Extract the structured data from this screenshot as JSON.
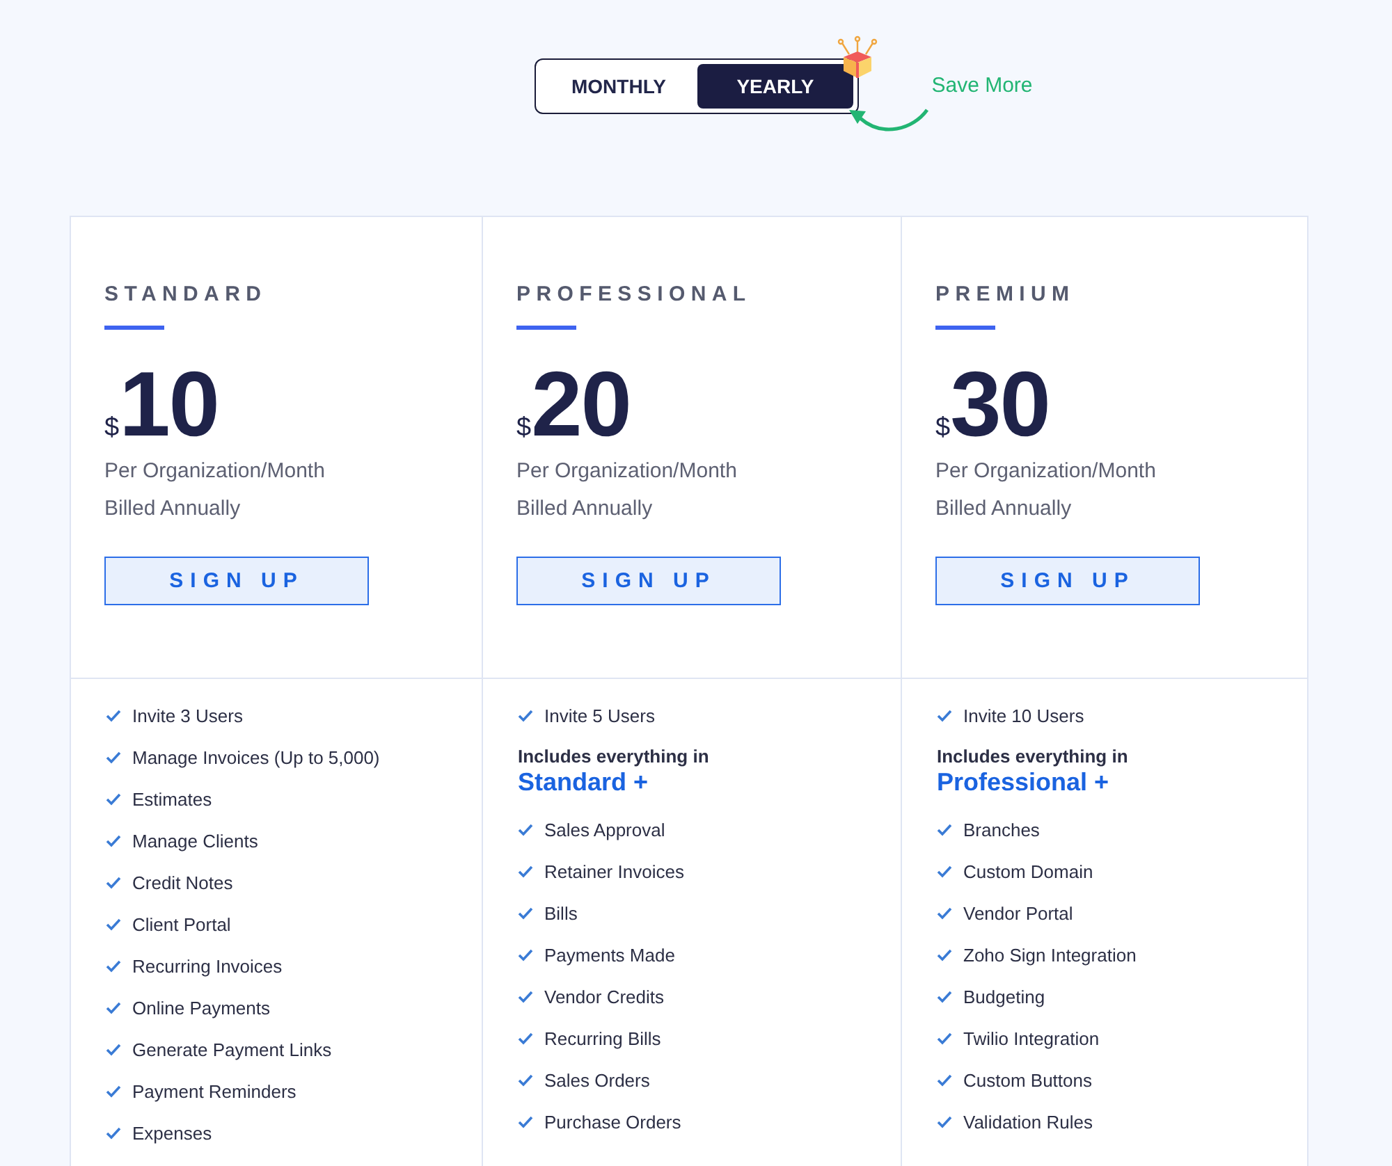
{
  "billing_toggle": {
    "options": [
      {
        "label": "MONTHLY",
        "selected": false
      },
      {
        "label": "YEARLY",
        "selected": true
      }
    ],
    "promo": "Save More"
  },
  "plans": [
    {
      "name": "STANDARD",
      "currency": "$",
      "price": "10",
      "period": "Per Organization/Month",
      "billing": "Billed Annually",
      "button": "SIGN UP",
      "features": [
        {
          "kind": "check",
          "text": "Invite 3 Users"
        },
        {
          "kind": "check",
          "text": "Manage Invoices (Up to 5,000)"
        },
        {
          "kind": "check",
          "text": "Estimates"
        },
        {
          "kind": "check",
          "text": "Manage Clients"
        },
        {
          "kind": "check",
          "text": "Credit Notes"
        },
        {
          "kind": "check",
          "text": "Client Portal"
        },
        {
          "kind": "check",
          "text": "Recurring Invoices"
        },
        {
          "kind": "check",
          "text": "Online Payments"
        },
        {
          "kind": "check",
          "text": "Generate Payment Links"
        },
        {
          "kind": "check",
          "text": "Payment Reminders"
        },
        {
          "kind": "check",
          "text": "Expenses"
        }
      ]
    },
    {
      "name": "PROFESSIONAL",
      "currency": "$",
      "price": "20",
      "period": "Per Organization/Month",
      "billing": "Billed Annually",
      "button": "SIGN UP",
      "features": [
        {
          "kind": "check",
          "text": "Invite 5 Users"
        },
        {
          "kind": "includes",
          "text": "Includes everything in",
          "link": "Standard +"
        },
        {
          "kind": "check",
          "text": "Sales Approval"
        },
        {
          "kind": "check",
          "text": "Retainer Invoices"
        },
        {
          "kind": "check",
          "text": "Bills"
        },
        {
          "kind": "check",
          "text": "Payments Made"
        },
        {
          "kind": "check",
          "text": "Vendor Credits"
        },
        {
          "kind": "check",
          "text": "Recurring Bills"
        },
        {
          "kind": "check",
          "text": "Sales Orders"
        },
        {
          "kind": "check",
          "text": "Purchase Orders"
        }
      ]
    },
    {
      "name": "PREMIUM",
      "currency": "$",
      "price": "30",
      "period": "Per Organization/Month",
      "billing": "Billed Annually",
      "button": "SIGN UP",
      "features": [
        {
          "kind": "check",
          "text": "Invite 10 Users"
        },
        {
          "kind": "includes",
          "text": "Includes everything in",
          "link": "Professional +"
        },
        {
          "kind": "check",
          "text": "Branches"
        },
        {
          "kind": "check",
          "text": "Custom Domain"
        },
        {
          "kind": "check",
          "text": "Vendor Portal"
        },
        {
          "kind": "check",
          "text": "Zoho Sign Integration"
        },
        {
          "kind": "check",
          "text": "Budgeting"
        },
        {
          "kind": "check",
          "text": "Twilio Integration"
        },
        {
          "kind": "check",
          "text": "Custom Buttons"
        },
        {
          "kind": "check",
          "text": "Validation Rules"
        }
      ]
    }
  ]
}
